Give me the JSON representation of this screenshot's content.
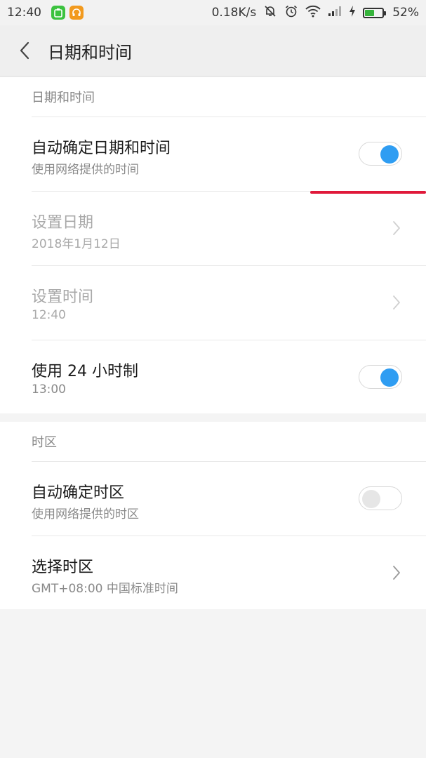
{
  "status_bar": {
    "time": "12:40",
    "net_speed": "0.18K/s",
    "battery_percent": "52%",
    "battery_level": 0.52,
    "icons": [
      "app-green-icon",
      "app-headphone-icon",
      "mute-icon",
      "alarm-icon",
      "wifi-icon",
      "signal-icon",
      "charging-icon",
      "battery-icon"
    ]
  },
  "header": {
    "title": "日期和时间"
  },
  "section_datetime": {
    "header": "日期和时间",
    "auto_datetime": {
      "title": "自动确定日期和时间",
      "subtitle": "使用网络提供的时间",
      "enabled": true
    },
    "set_date": {
      "title": "设置日期",
      "subtitle": "2018年1月12日"
    },
    "set_time": {
      "title": "设置时间",
      "subtitle": "12:40"
    },
    "use_24h": {
      "title": "使用 24 小时制",
      "subtitle": "13:00",
      "enabled": true
    }
  },
  "section_timezone": {
    "header": "时区",
    "auto_timezone": {
      "title": "自动确定时区",
      "subtitle": "使用网络提供的时区",
      "enabled": false
    },
    "select_timezone": {
      "title": "选择时区",
      "subtitle": "GMT+08:00 中国标准时间"
    }
  },
  "colors": {
    "accent": "#2f9df2",
    "annotation_red": "#e0193a"
  }
}
